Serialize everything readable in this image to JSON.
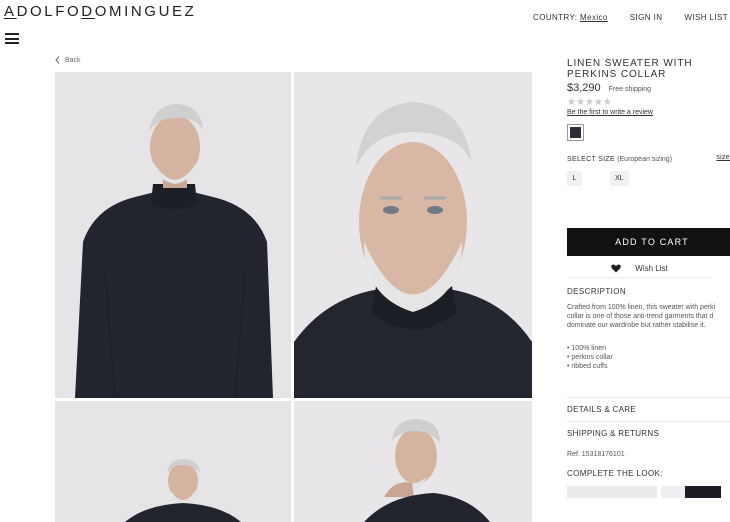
{
  "header": {
    "logo": {
      "part1": "A",
      "part2": "DOLFO",
      "part3": "D",
      "part4": "OMINGUEZ"
    },
    "country_label": "COUNTRY:",
    "country_value": "Mexico",
    "signin": "SIGN IN",
    "wishlist": "WISH LIST"
  },
  "nav": {
    "back": "Back"
  },
  "gallery": {
    "photos": [
      "model-front-view",
      "model-closeup",
      "model-seated",
      "model-profile-hand-on-chin"
    ]
  },
  "product": {
    "name": "LINEN SWEATER WITH PERKINS COLLAR",
    "price": "$3,290",
    "shipping": "Free shipping",
    "rating": 0,
    "rating_max": 5,
    "review_link": "Be the first to write a review",
    "color_swatch": "#2a2e38",
    "select_size_label": "SELECT SIZE",
    "size_sub": "(European sizing)",
    "size_guide": "size",
    "sizes": [
      "L",
      "XL"
    ],
    "add_to_cart": "ADD TO CART",
    "wish_list": "Wish List",
    "description_title": "DESCRIPTION",
    "description_lines": [
      "Crafted from 100% linen, this sweater with perki",
      "collar is one of those anti-trend garments that d",
      "dominate our wardrobe but rather stabilise it."
    ],
    "features": [
      "100% linen",
      "perkins collar",
      "ribbed cuffs"
    ],
    "details_care": "DETAILS & CARE",
    "shipping_returns": "SHIPPING & RETURNS",
    "ref": "Ref. 15318176101",
    "complete_look": "COMPLETE THE LOOK:"
  }
}
